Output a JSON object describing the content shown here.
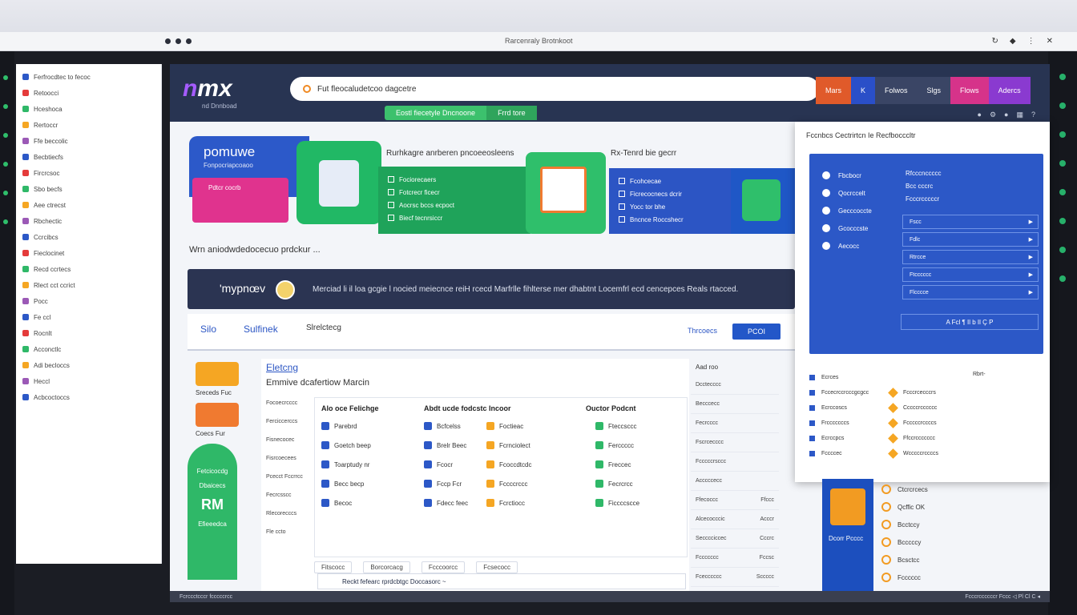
{
  "window": {
    "title": "Rarcenraly Brotnkoot"
  },
  "explorer": {
    "items": [
      "Ferfrocdtec to fecoc",
      "Retoocci",
      "Hceshoca",
      "Rertoccr",
      "Ffe beccolic",
      "Becbtiecfs",
      "Fircrcsoc",
      "Sbo becfs",
      "Aee ctrecst",
      "Rbchectic",
      "Ccrcibcs",
      "Fieclocinet",
      "Recd ccrtecs",
      "Rlect cct ccrict",
      "Pocc",
      "Fe ccl",
      "Rocnlt",
      "Acconctlc",
      "Adi becloccs",
      "Heccl",
      "Acbcoctoccs"
    ]
  },
  "header": {
    "logo_text": "mx",
    "logo_prefix": "n",
    "logo_sub": "nd Dnnboad",
    "search_value": "Fut fleocaludetcoo dagcetre",
    "tabs": [
      "Mars",
      "K",
      "Folwos",
      "Slgs",
      "Flows",
      "Adercs"
    ],
    "chips": [
      "Eostl fiecetyle Dncnoone",
      "Frrd tore"
    ],
    "icons": [
      "bell-icon",
      "gear-icon",
      "user-icon",
      "grid-icon",
      "help-icon"
    ]
  },
  "banner": {
    "blue_title": "pomuwe",
    "blue_sub": "Fonpocriapcoaoo",
    "pink_label": "Pdtcr cocrb",
    "title1": "Rurhkagre anrberen pncoeeosleens",
    "list1": [
      "Fociorecaers",
      "Fotcrecr ficecr",
      "Aocrsc bccs ecpoct",
      "Biecf tecnrsiccr"
    ],
    "title2": "Rx-Tenrd bie gecrr",
    "list2": [
      "Fcohcecae",
      "Ficrecocnecs dcrir",
      "Yocc tor bhe",
      "Bncnce Roccshecr"
    ]
  },
  "info_line": "Wrn aniodwdedocecuo prdckur ...",
  "darkbar": {
    "name": "'mypnœv",
    "text": "Merciad li il loa gcgie l nocied meiecnce reiH rcecd Marfrlle fihlterse mer dhabtnt Locemfrl ecd cencepces Reals rtacced."
  },
  "toolrow": {
    "a": "Silo",
    "b": "Sulfinek",
    "c": "Slrelctecg",
    "d": "Thrcoecs",
    "button": "PCOI"
  },
  "lside": {
    "labels": [
      "Sreceds Fuc",
      "Coecs Fur"
    ],
    "green_labels": [
      "Fetcicocdg",
      "Dbaicecs",
      "RM",
      "Efieeedca"
    ]
  },
  "features": {
    "title": "Eletcng",
    "subtitle": "Emmive dcafertiow Marcin",
    "col0": [
      "Focoecrcccc",
      "Ferciccerccs",
      "Fisnecocec",
      "Fisrcoecees",
      "Pcecct Fccrrcc",
      "Fecrcsscc",
      "Rlecorecccs",
      "Fle ccto"
    ],
    "heads": [
      "Alo oce Felichge",
      "Abdt ucde fodcstc Incoor",
      "Ouctor Podcnt"
    ],
    "col1": [
      "Parebrd",
      "Goetch beep",
      "Toarptudy nr",
      "Becc becp",
      "Becoc"
    ],
    "col2": [
      "Bcfcelss",
      "Brelr Beec",
      "Fcocr",
      "Fccp Fcr",
      "Fdecc feec"
    ],
    "col3": [
      "Foctieac",
      "Fcrnciolect",
      "Fcoccdtcdc",
      "Fccccrccc",
      "Fcrctiocc"
    ],
    "col4": [
      "Fteccsccc",
      "Ferccccc",
      "Freccec",
      "Fecrcrcc",
      "Ficcccscce"
    ],
    "foot": [
      "Fitscocc",
      "Borcorcacg",
      "Fcccoorcc",
      "Fcsecocc"
    ],
    "status": "Reckt fefearc rprdcbtgc Doccasorc ~"
  },
  "rlist": {
    "header": "Aad roo",
    "rows": [
      [
        "Dcctecccc",
        ""
      ],
      [
        "Becccecc",
        ""
      ],
      [
        "Fecrcccc",
        ""
      ],
      [
        "Fscrcecccc",
        ""
      ],
      [
        "Fcccccrsccc",
        ""
      ],
      [
        "Acccccecc",
        ""
      ],
      [
        "Ffecoccc",
        "Ffccc"
      ],
      [
        "Alcecocccic",
        "Acccr"
      ],
      [
        "Secccciccec",
        "Cccrc"
      ],
      [
        "Fccccccc",
        "Fccsc"
      ],
      [
        "Fcecccccc",
        "Sccccc"
      ]
    ]
  },
  "overlay": {
    "header": "Fccnbcs Cectrirtcn Ie Recfbocccltr",
    "panel_left": [
      "Fbcbocr",
      "Qocrccelt",
      "Gecccoccte",
      "Gcocccste",
      "Aecocc"
    ],
    "panel_right": [
      "Rfcccnccccc",
      "Bcc cccrc",
      "Fcccrcccccr"
    ],
    "inputs": [
      "Fscc",
      "Fdlc",
      "Rtrcce",
      "Ftcccccc",
      "Flcccce"
    ],
    "toolbar": "A Fcl ¶ Il b Il Ç P",
    "list_left": [
      "Ecrces",
      "Fccecrccrcccgcgcc",
      "Ecrccoscs",
      "Frcccccccs",
      "Ecrccpcs",
      "Fccccec"
    ],
    "list_right": [
      "Fcccrcecccrs",
      "Cccccrcccccc",
      "Fcccccrccccs",
      "Ffccrccccccc",
      "Wcccccrccccs"
    ],
    "side_label": "Rbrt-"
  },
  "orange_tile": {
    "label": "Dcorr Pcccc"
  },
  "bottom_list": [
    "Ctcrcrcecs",
    "Qcffic OK",
    "Bcctccy",
    "Bcccccy",
    "Bcsctcc",
    "Fcccccc"
  ],
  "statusbar": {
    "left": "Fcrccctcccr fcccccrcc",
    "right": "Fcccrccccccr Fccc ◁ Pl Cl C ◂"
  }
}
